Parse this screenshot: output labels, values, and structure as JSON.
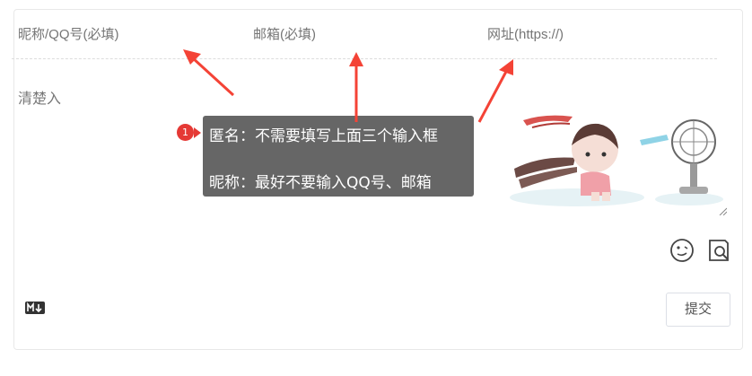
{
  "form": {
    "nick_placeholder": "昵称/QQ号(必填)",
    "mail_placeholder": "邮箱(必填)",
    "url_placeholder": "网址(https://)",
    "editor_placeholder": "清楚入",
    "submit_label": "提交"
  },
  "tooltip": {
    "badge": "1",
    "line1": "匿名：不需要填写上面三个输入框",
    "line2": "昵称：最好不要输入QQ号、邮箱"
  },
  "icons": [
    "emoji-icon",
    "preview-icon",
    "markdown-icon",
    "resize-grip-icon"
  ],
  "colors": {
    "annotation_red": "#f44336",
    "tooltip_bg": "#666666",
    "badge_red": "#e53935"
  }
}
